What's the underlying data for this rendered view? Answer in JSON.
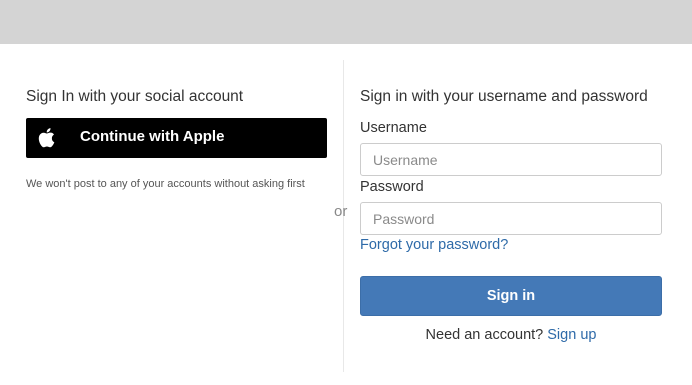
{
  "colors": {
    "top_bar": "#d4d4d4",
    "apple_button_bg": "#000000",
    "primary_button_bg": "#4479b7",
    "link": "#2e6aa8"
  },
  "social": {
    "title": "Sign In with your social account",
    "apple_button": {
      "icon": "apple-logo-icon",
      "label": "Continue with Apple"
    },
    "note": "We won't post to any of your accounts without asking first"
  },
  "separator": {
    "label": "or"
  },
  "credentials": {
    "title": "Sign in with your username and password",
    "username": {
      "label": "Username",
      "placeholder": "Username",
      "value": ""
    },
    "password": {
      "label": "Password",
      "placeholder": "Password",
      "value": ""
    },
    "forgot_link": "Forgot your password?",
    "submit_label": "Sign in",
    "signup_prompt": "Need an account?",
    "signup_link": "Sign up"
  }
}
